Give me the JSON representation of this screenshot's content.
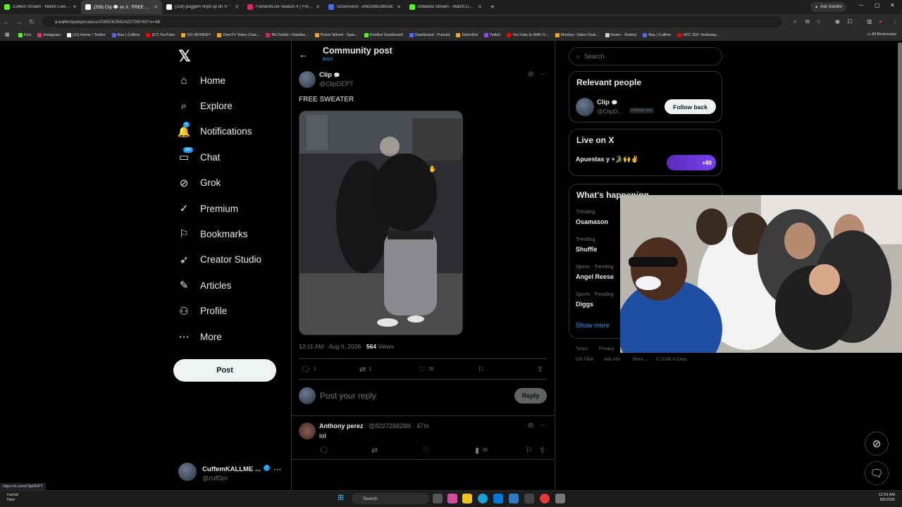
{
  "browser": {
    "tabs": [
      {
        "label": "Cuffem Stream - Watch Live on",
        "color": "#53fc18",
        "active": false
      },
      {
        "label": "(259) Clip 💬 on X: \"FREE SWEA",
        "color": "#ffffff",
        "active": true
      },
      {
        "label": "(258) puggem floyd up on X: \"",
        "color": "#ffffff",
        "active": false
      },
      {
        "label": "FishtankLive Season 4 | Freddy",
        "color": "#e0245e",
        "active": false
      },
      {
        "label": "Screenshot - e9819fdc3891bc",
        "color": "#4a6cf7",
        "active": false
      },
      {
        "label": "595kebo Stream - Watch Live o",
        "color": "#53fc18",
        "active": false
      }
    ],
    "new_tab": "+",
    "gemini_label": "Ask Gemini",
    "url_host": "x.com",
    "url_path": "/clipdept/status/2085262582420799765?s=46",
    "bookmarks": [
      {
        "label": "Kick",
        "color": "#53fc18"
      },
      {
        "label": "Instagram",
        "color": "#e1306c"
      },
      {
        "label": "(12) Home / Twitter",
        "color": "#ffffff"
      },
      {
        "label": "Bau | Cuffem",
        "color": "#5865f2"
      },
      {
        "label": "(57) YouTube",
        "color": "#ff0000"
      },
      {
        "label": "OG MONKEY",
        "color": "#f5a623"
      },
      {
        "label": "OmeTV Video Chat...",
        "color": "#f5a623"
      },
      {
        "label": "IRLToolkit • Dashbo...",
        "color": "#e0245e"
      },
      {
        "label": "Picker Wheel - Spin...",
        "color": "#f5a623"
      },
      {
        "label": "KickBot Dashboard",
        "color": "#53fc18"
      },
      {
        "label": "Dashboard - Pulsoid",
        "color": "#4a6cf7"
      },
      {
        "label": "DistroKid",
        "color": "#f5a623"
      },
      {
        "label": "Twitch",
        "color": "#9146ff"
      },
      {
        "label": "YouTube to WAV D...",
        "color": "#ff0000"
      },
      {
        "label": "Monkey: Video Chat...",
        "color": "#f5a623"
      },
      {
        "label": "Home - Roblox",
        "color": "#cccccc"
      },
      {
        "label": "Bau | Cuffem",
        "color": "#5865f2"
      },
      {
        "label": "UFC 326: Holloway...",
        "color": "#d20a0a"
      }
    ],
    "all_bookmarks": "All Bookmarks",
    "status_url": "https://x.com/ClipDEPT"
  },
  "nav": {
    "items": [
      {
        "label": "Home",
        "icon": "home-icon",
        "glyph": "⌂"
      },
      {
        "label": "Explore",
        "icon": "search-icon",
        "glyph": "⌕"
      },
      {
        "label": "Notifications",
        "icon": "bell-icon",
        "glyph": "🔔",
        "badge": "6"
      },
      {
        "label": "Chat",
        "icon": "chat-icon",
        "glyph": "▭",
        "badge": "20+"
      },
      {
        "label": "Grok",
        "icon": "grok-icon",
        "glyph": "⊘"
      },
      {
        "label": "Premium",
        "icon": "premium-icon",
        "glyph": "✓"
      },
      {
        "label": "Bookmarks",
        "icon": "bookmark-icon",
        "glyph": "⚐"
      },
      {
        "label": "Creator Studio",
        "icon": "rocket-icon",
        "glyph": "➶"
      },
      {
        "label": "Articles",
        "icon": "articles-icon",
        "glyph": "✎"
      },
      {
        "label": "Profile",
        "icon": "profile-icon",
        "glyph": "⚇"
      },
      {
        "label": "More",
        "icon": "more-icon",
        "glyph": "⋯"
      }
    ],
    "post_label": "Post",
    "account_name": "CuffemKALLME ...",
    "account_handle": "@cuff3m"
  },
  "post": {
    "header_title": "Community post",
    "header_sub": "BAU",
    "author_name": "Clip",
    "author_handle": "@ClipDEPT",
    "text": "FREE SWEATER",
    "time": "12:11 AM · Aug 6, 2026 · ",
    "views_count": "564",
    "views_label": " Views",
    "replies": "1",
    "reposts": "1",
    "likes": "26",
    "reply_placeholder": "Post your reply",
    "reply_button": "Reply"
  },
  "comment": {
    "name": "Anthony perez",
    "handle": "@822728828lll · 47m",
    "text": "lol",
    "views": "38"
  },
  "sidebar": {
    "search_placeholder": "Search",
    "relevant_title": "Relevant people",
    "rp_name": "Clip",
    "rp_handle": "@ClipD...",
    "rp_follows": "Follows you",
    "follow_back": "Follow back",
    "live_title": "Live on X",
    "live_item": "Apuestas y +🐊🙌✌",
    "live_count": "+80",
    "happening_title": "What's happening",
    "trends": [
      {
        "label": "Trending",
        "name": "Osamason"
      },
      {
        "label": "Trending",
        "name": "Shuffle"
      },
      {
        "label": "Sports · Trending",
        "name": "Angel Reese"
      },
      {
        "label": "Sports · Trending",
        "name": "Diggs"
      }
    ],
    "show_more": "Show more",
    "footer": [
      "Terms",
      "Privacy",
      "US TIDA",
      "Ads info",
      "More ...",
      "© 2026 X Corp."
    ]
  },
  "taskbar": {
    "weather_temp": "Humid",
    "weather_sub": "Now",
    "search": "Search",
    "time": "12:59 AM",
    "date": "8/6/2026"
  }
}
